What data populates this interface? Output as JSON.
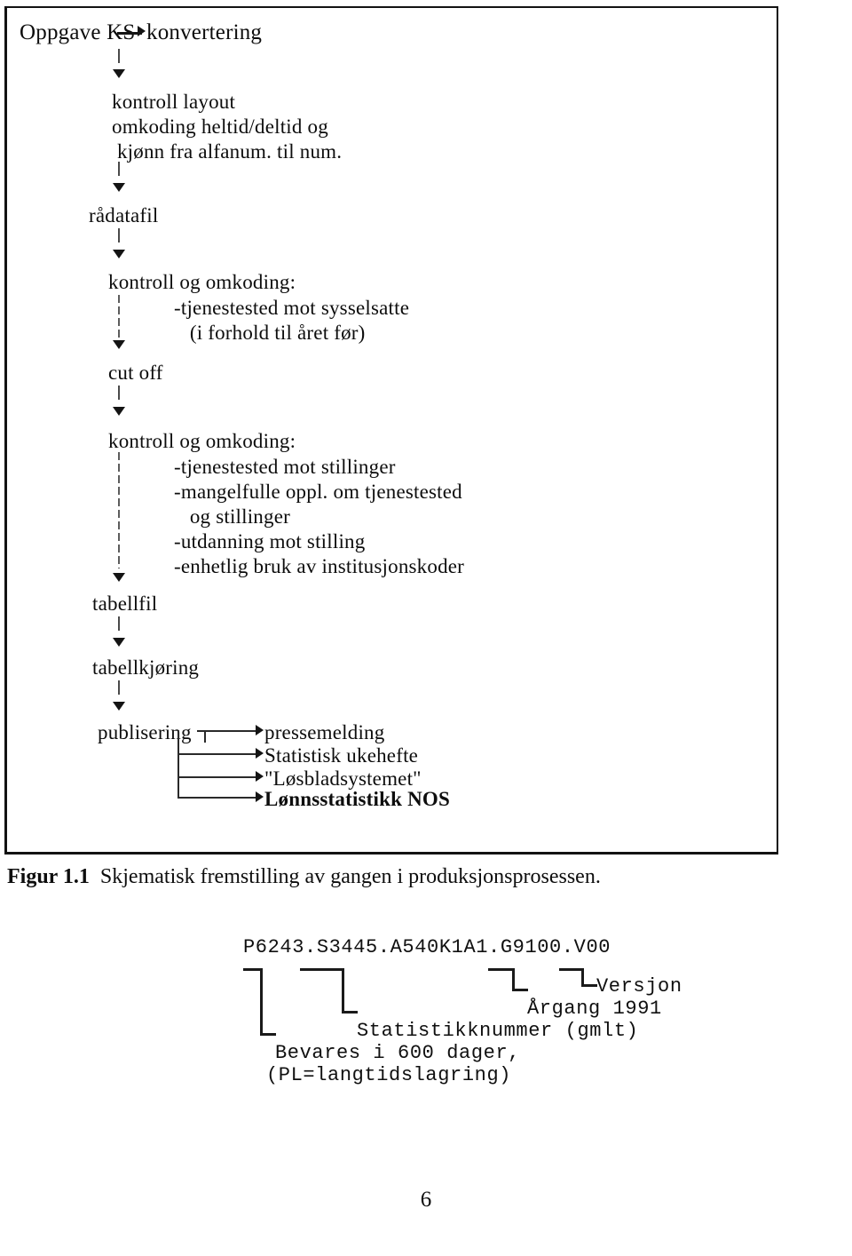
{
  "figure": {
    "start_node": "Oppgave KS",
    "start_target": "konvertering",
    "steps": [
      {
        "id": "konvertering-detail",
        "lines": [
          "kontroll layout",
          "omkoding heltid/deltid og",
          " kjønn fra alfanum. til num."
        ]
      },
      {
        "id": "radatafil",
        "label": "rådatafil"
      },
      {
        "id": "kontroll-omkoding-1",
        "label": "kontroll og omkoding:",
        "items": [
          "-tjenestested mot sysselsatte",
          "   (i forhold til året før)"
        ]
      },
      {
        "id": "cut-off",
        "label": "cut off"
      },
      {
        "id": "kontroll-omkoding-2",
        "label": "kontroll og omkoding:",
        "items": [
          "-tjenestested mot stillinger",
          "-mangelfulle oppl. om tjenestested",
          "   og stillinger",
          "-utdanning mot stilling",
          "-enhetlig bruk av institusjonskoder"
        ]
      },
      {
        "id": "tabellfil",
        "label": "tabellfil"
      },
      {
        "id": "tabellkjoring",
        "label": "tabellkjøring"
      },
      {
        "id": "publisering",
        "label": "publisering"
      }
    ],
    "publications": [
      "pressemelding",
      "Statistisk ukehefte",
      "\"Løsbladsystemet\"",
      "Lønnsstatistikk NOS"
    ]
  },
  "caption": {
    "number": "Figur 1.1",
    "text": "Skjematisk fremstilling av gangen i produksjonsprosessen."
  },
  "dataset_name": {
    "filename": "P6243.S3445.A540K1A1.G9100.V00",
    "annotations": [
      {
        "id": "versjon",
        "label": "Versjon"
      },
      {
        "id": "argang",
        "label": "Årgang 1991"
      },
      {
        "id": "statistikknummer",
        "label": "Statistikknummer (gmlt)"
      },
      {
        "id": "bevares",
        "label": "Bevares i 600 dager,"
      },
      {
        "id": "bevares-2",
        "label": "(PL=langtidslagring)"
      }
    ]
  },
  "page_number": "6"
}
